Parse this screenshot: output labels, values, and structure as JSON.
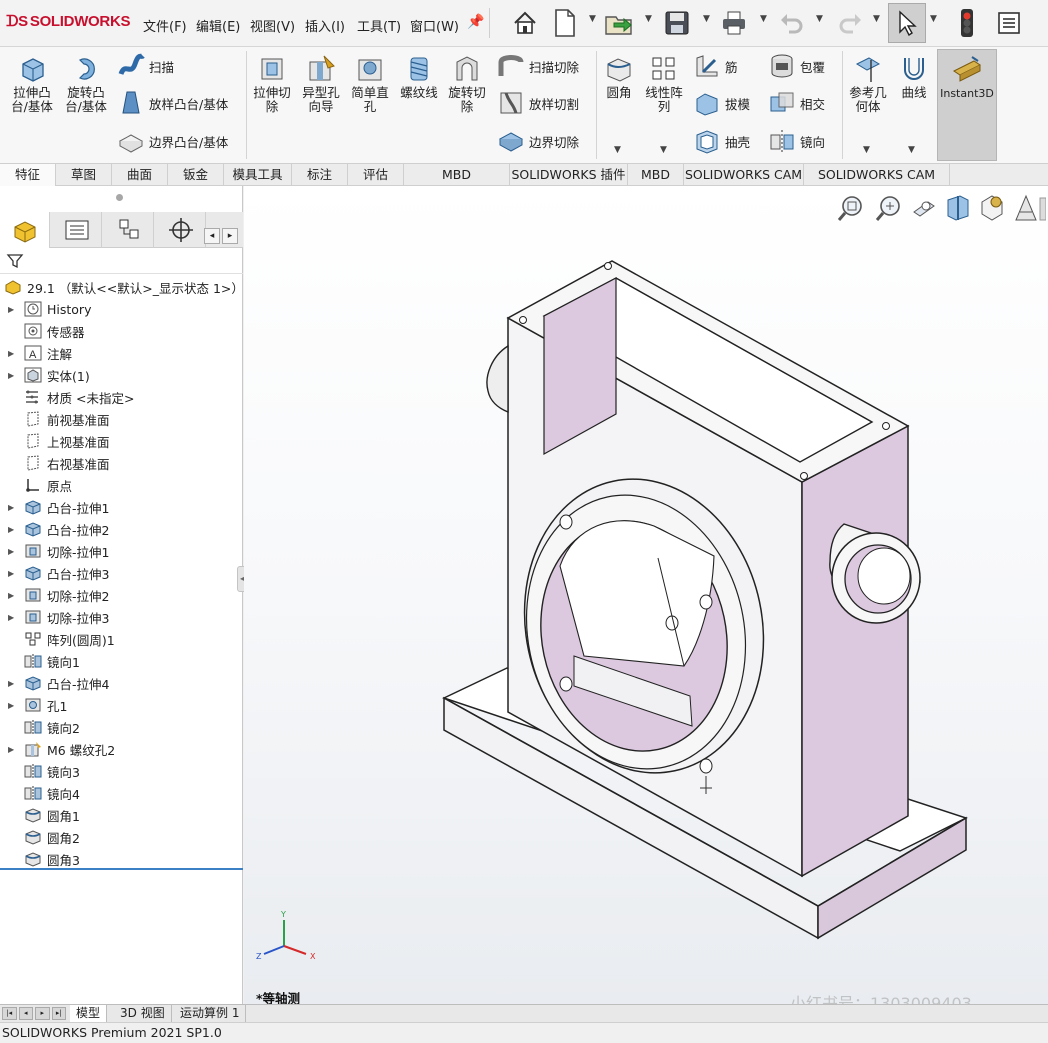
{
  "app": {
    "logo": "SOLIDWORKS"
  },
  "menu": [
    "文件(F)",
    "编辑(E)",
    "视图(V)",
    "插入(I)",
    "工具(T)",
    "窗口(W)"
  ],
  "icons": [
    "home-icon",
    "new-document-icon",
    "open-icon",
    "save-icon",
    "print-icon",
    "undo-icon",
    "redo-icon",
    "select-cursor-icon",
    "traffic-light-icon",
    "options-icon"
  ],
  "ribbon": {
    "extrude_boss": "拉伸凸\n台/基体",
    "revolve_boss": "旋转凸\n台/基体",
    "sweep": "扫描",
    "loft_boss": "放样凸台/基体",
    "boundary_boss": "边界凸台/基体",
    "extrude_cut": "拉伸切\n除",
    "hole_wizard": "异型孔\n向导",
    "simple_hole": "简单直\n孔",
    "helix": "螺纹线",
    "revolve_cut": "旋转切\n除",
    "swept_cut": "扫描切除",
    "lofted_cut": "放样切割",
    "boundary_cut": "边界切除",
    "fillet": "圆角",
    "linear_pattern": "线性阵\n列",
    "rib": "筋",
    "draft": "拔模",
    "shell": "抽壳",
    "wrap": "包覆",
    "intersect": "相交",
    "mirror": "镜向",
    "ref_geometry": "参考几\n何体",
    "curves": "曲线",
    "instant3d": "Instant3D"
  },
  "command_tabs": [
    "特征",
    "草图",
    "曲面",
    "钣金",
    "模具工具",
    "标注",
    "评估",
    "MBD Dimensions",
    "SOLIDWORKS 插件",
    "MBD",
    "SOLIDWORKS CAM",
    "SOLIDWORKS CAM TBM"
  ],
  "tree": {
    "root": "29.1 （默认<<默认>_显示状态 1>）",
    "items": [
      {
        "label": "History",
        "arrow": true,
        "icon": "history-icon"
      },
      {
        "label": "传感器",
        "arrow": false,
        "icon": "sensor-icon"
      },
      {
        "label": "注解",
        "arrow": true,
        "icon": "annotation-icon"
      },
      {
        "label": "实体(1)",
        "arrow": true,
        "icon": "solid-bodies-icon"
      },
      {
        "label": "材质 <未指定>",
        "arrow": false,
        "icon": "material-icon"
      },
      {
        "label": "前视基准面",
        "arrow": false,
        "icon": "plane-icon"
      },
      {
        "label": "上视基准面",
        "arrow": false,
        "icon": "plane-icon"
      },
      {
        "label": "右视基准面",
        "arrow": false,
        "icon": "plane-icon"
      },
      {
        "label": "原点",
        "arrow": false,
        "icon": "origin-icon"
      },
      {
        "label": "凸台-拉伸1",
        "arrow": true,
        "icon": "boss-extrude-icon"
      },
      {
        "label": "凸台-拉伸2",
        "arrow": true,
        "icon": "boss-extrude-icon"
      },
      {
        "label": "切除-拉伸1",
        "arrow": true,
        "icon": "cut-extrude-icon"
      },
      {
        "label": "凸台-拉伸3",
        "arrow": true,
        "icon": "boss-extrude-icon"
      },
      {
        "label": "切除-拉伸2",
        "arrow": true,
        "icon": "cut-extrude-icon"
      },
      {
        "label": "切除-拉伸3",
        "arrow": true,
        "icon": "cut-extrude-icon"
      },
      {
        "label": "阵列(圆周)1",
        "arrow": false,
        "icon": "circular-pattern-icon"
      },
      {
        "label": "镜向1",
        "arrow": false,
        "icon": "mirror-icon"
      },
      {
        "label": "凸台-拉伸4",
        "arrow": true,
        "icon": "boss-extrude-icon"
      },
      {
        "label": "孔1",
        "arrow": true,
        "icon": "hole-icon"
      },
      {
        "label": "镜向2",
        "arrow": false,
        "icon": "mirror-icon"
      },
      {
        "label": "M6 螺纹孔2",
        "arrow": true,
        "icon": "hole-wizard-icon"
      },
      {
        "label": "镜向3",
        "arrow": false,
        "icon": "mirror-icon"
      },
      {
        "label": "镜向4",
        "arrow": false,
        "icon": "mirror-icon"
      },
      {
        "label": "圆角1",
        "arrow": false,
        "icon": "fillet-icon"
      },
      {
        "label": "圆角2",
        "arrow": false,
        "icon": "fillet-icon"
      },
      {
        "label": "圆角3",
        "arrow": false,
        "icon": "fillet-icon"
      }
    ]
  },
  "viewport": {
    "view_label": "*等轴测",
    "watermark": "小红书号：1303009403",
    "axis_y": "Y",
    "axis_x": "X",
    "axis_z": "Z"
  },
  "bottom_tabs": [
    "模型",
    "3D 视图",
    "运动算例 1"
  ],
  "status": "SOLIDWORKS Premium 2021 SP1.0"
}
